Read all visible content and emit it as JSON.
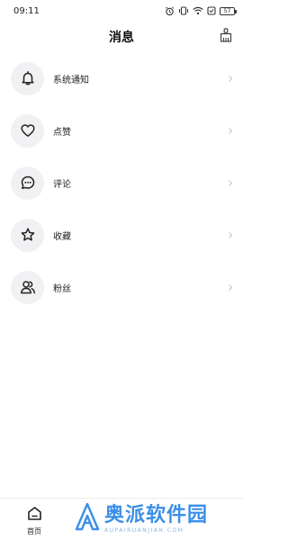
{
  "status_bar": {
    "time": "09:11",
    "battery": "57",
    "icons": [
      "alarm-icon",
      "vibrate-icon",
      "wifi-icon",
      "notification-icon",
      "battery-icon"
    ]
  },
  "header": {
    "title": "消息",
    "right_icon": "broom-icon"
  },
  "messages": {
    "items": [
      {
        "label": "系统通知",
        "icon": "bell-icon"
      },
      {
        "label": "点赞",
        "icon": "heart-icon"
      },
      {
        "label": "评论",
        "icon": "comment-icon"
      },
      {
        "label": "收藏",
        "icon": "star-icon"
      },
      {
        "label": "粉丝",
        "icon": "users-icon"
      }
    ]
  },
  "bottom_nav": {
    "home_label": "首页",
    "home_icon": "home-icon"
  },
  "watermark": {
    "title": "奥派软件园",
    "subtitle": "AUPAIRUANJIAN.COM",
    "color": "#3b8fe8"
  }
}
